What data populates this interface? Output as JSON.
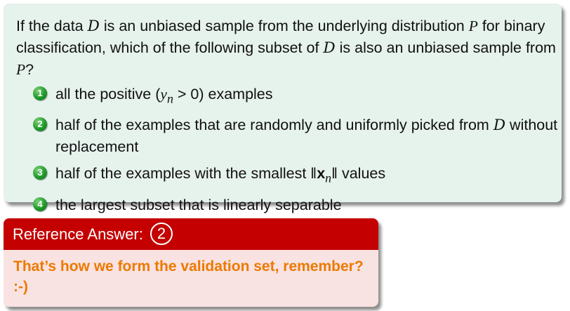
{
  "question": {
    "t1": "If the data ",
    "d1": "D",
    "t2": " is an unbiased sample from the underlying distribution ",
    "p1": "P",
    "t3": " for binary classification, which of the following subset of ",
    "d2": "D",
    "t4": " is also an unbiased sample from ",
    "p2": "P",
    "t5": "?"
  },
  "options": [
    {
      "number": "1",
      "pre": "all the positive (",
      "y": "y",
      "n": "n",
      "cond": " > 0",
      "post": ") examples"
    },
    {
      "number": "2",
      "pre": "half of the examples that are randomly and uniformly picked from ",
      "d": "D",
      "post": " without replacement"
    },
    {
      "number": "3",
      "pre": "half of the examples with the smallest ",
      "norm_open": "‖",
      "x": "x",
      "n": "n",
      "norm_close": "‖",
      "post": " values"
    },
    {
      "number": "4",
      "text": "the largest subset that is linearly separable"
    }
  ],
  "answer": {
    "header": "Reference Answer:",
    "choice": "2",
    "body": "That’s how we form the validation set, remember? :-)"
  },
  "colors": {
    "question_bg": "#e6f2ec",
    "badge_green": "#1f9a2a",
    "answer_header_bg": "#c40000",
    "answer_body_bg": "#f9e2e2",
    "answer_text": "#ec7a00"
  }
}
